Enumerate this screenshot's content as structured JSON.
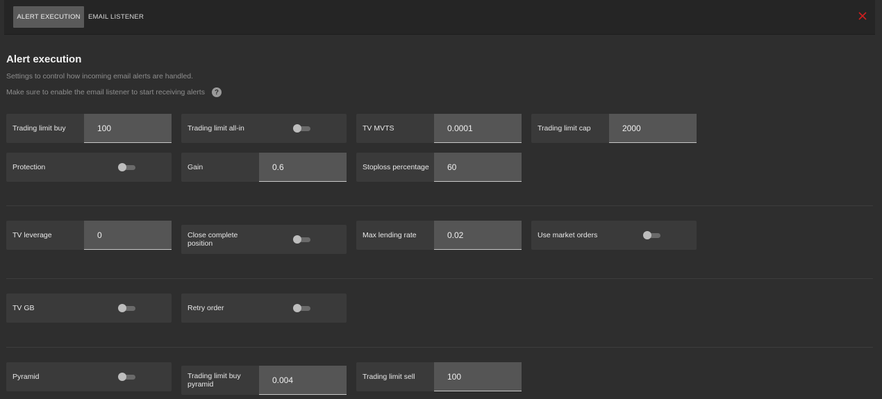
{
  "tabs": [
    {
      "label": "ALERT EXECUTION",
      "active": true
    },
    {
      "label": "EMAIL LISTENER",
      "active": false
    }
  ],
  "close_icon": "close-icon",
  "colors": {
    "accent_close": "#d01f1f",
    "input_bg": "#555555",
    "card_bg": "#3a3a3a"
  },
  "header": {
    "title": "Alert execution",
    "subtitle": "Settings to control how incoming email alerts are handled.",
    "note": "Make sure to enable the email listener to start receiving alerts",
    "help_icon": "question-mark-icon",
    "help_glyph": "?"
  },
  "settings": {
    "trading_limit_buy": {
      "label": "Trading limit buy",
      "value": "100"
    },
    "trading_limit_all_in": {
      "label": "Trading limit all-in",
      "enabled": false
    },
    "tv_mvts": {
      "label": "TV MVTS",
      "value": "0.0001"
    },
    "trading_limit_cap": {
      "label": "Trading limit cap",
      "value": "2000"
    },
    "protection": {
      "label": "Protection",
      "enabled": false
    },
    "gain": {
      "label": "Gain",
      "value": "0.6"
    },
    "stoploss_percentage": {
      "label": "Stoploss percentage",
      "value": "60"
    },
    "tv_leverage": {
      "label": "TV leverage",
      "value": "0"
    },
    "close_complete_position": {
      "label": "Close complete position",
      "enabled": false
    },
    "max_lending_rate": {
      "label": "Max lending rate",
      "value": "0.02"
    },
    "use_market_orders": {
      "label": "Use market orders",
      "enabled": false
    },
    "tv_gb": {
      "label": "TV GB",
      "enabled": false
    },
    "retry_order": {
      "label": "Retry order",
      "enabled": false
    },
    "pyramid": {
      "label": "Pyramid",
      "enabled": false
    },
    "trading_limit_buy_pyramid": {
      "label": "Trading limit buy pyramid",
      "value": "0.004"
    },
    "trading_limit_sell": {
      "label": "Trading limit sell",
      "value": "100"
    }
  }
}
